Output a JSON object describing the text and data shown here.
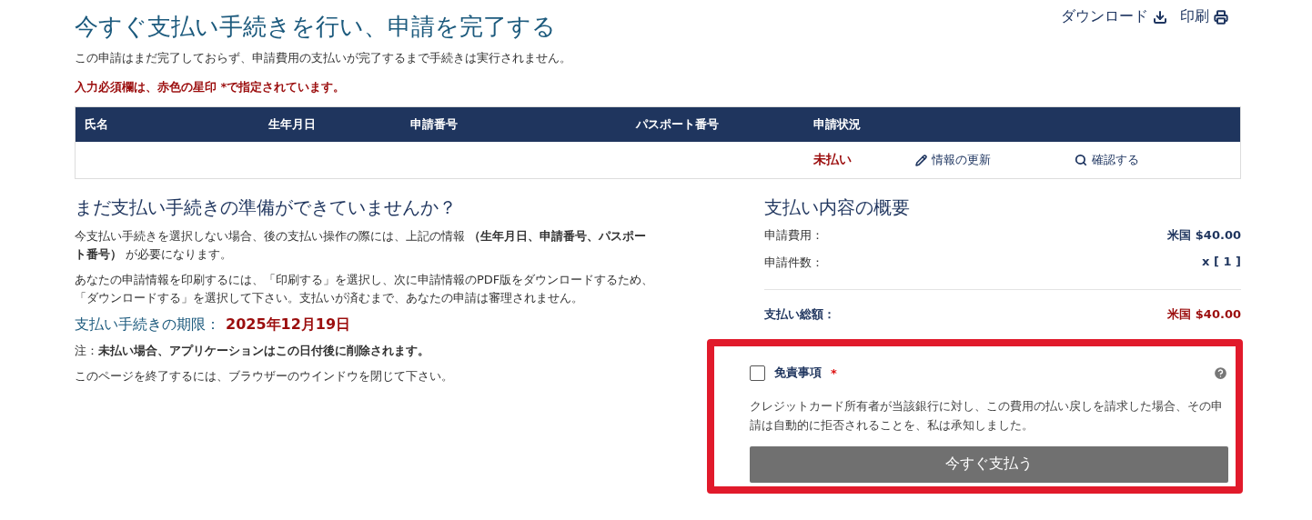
{
  "header_links": [
    {
      "kind": "download",
      "label": "ダウンロード"
    },
    {
      "kind": "print",
      "label": "印刷"
    }
  ],
  "title": "今すぐ支払い手続きを行い、申請を完了する",
  "intro": "この申請はまだ完了しておらず、申請費用の支払いが完了するまで手続きは実行されません。",
  "required_note": "入力必須欄は、赤色の星印 *で指定されています。",
  "table": {
    "columns": [
      "氏名",
      "生年月日",
      "申請番号",
      "パスポート番号",
      "申請状況"
    ],
    "rows": [
      {
        "status": "未払い",
        "actions": [
          {
            "kind": "edit",
            "label": "情報の更新"
          },
          {
            "kind": "view",
            "label": "確認する"
          }
        ]
      }
    ]
  },
  "not_ready": {
    "heading": "まだ支払い手続きの準備ができていませんか？",
    "paragraphs": [
      "今支払い手続きを選択しない場合、後の支払い操作の際には、上記の情報 **（生年月日、申請番号、パスポート番号）** が必要になります。",
      "あなたの申請情報を印刷するには、「印刷する」を選択し、次に申請情報のPDF版をダウンロードするため、「ダウンロードする」を選択して下さい。支払いが済むまで、あなたの申請は審理されません。"
    ],
    "deadline_label": "支払い手続きの期限：",
    "deadline_value": "2025年12月19日",
    "note": "注：**未払い場合、アプリケーションはこの日付後に削除されます。**",
    "closing": "このページを終了するには、ブラウザーのウインドウを閉じて下さい。"
  },
  "summary": {
    "heading": "支払い内容の概要",
    "lines": [
      {
        "label": "申請費用：",
        "value": "米国 $40.00"
      },
      {
        "label": "申請件数：",
        "value": "x [ 1 ]"
      }
    ],
    "total": {
      "label": "支払い総額：",
      "value": "米国 $40.00"
    }
  },
  "disclaimer": {
    "highlighted": true,
    "checked": false,
    "label": "免責事項",
    "required_mark": "*",
    "text": "クレジットカード所有者が当該銀行に対し、この費用の払い戻しを請求した場合、その申請は自動的に拒否されることを、私は承知しました。",
    "button": "今すぐ支払う"
  }
}
